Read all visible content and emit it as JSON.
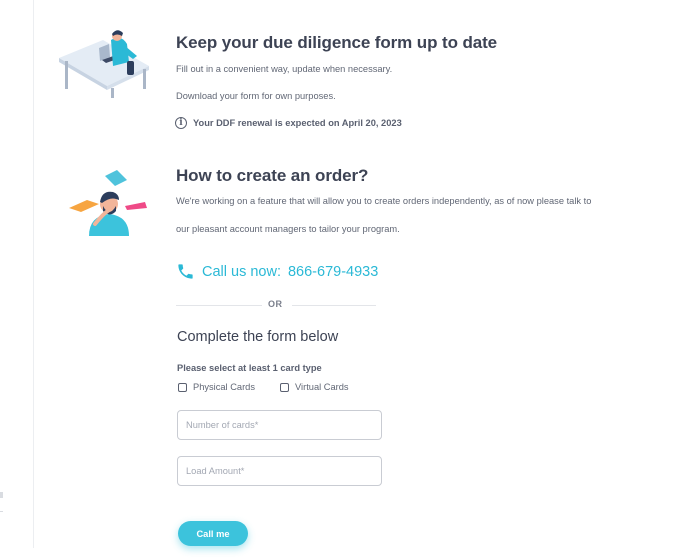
{
  "ddf": {
    "title": "Keep your due diligence form up to date",
    "line1": "Fill out in a convenient way, update when necessary.",
    "line2": "Download your form for own purposes.",
    "notice": "Your DDF renewal is expected on April 20, 2023",
    "notice_icon": "info-icon"
  },
  "order": {
    "title": "How to create an order?",
    "line1": "We're working on a feature that will allow you to create orders independently, as of now please talk to",
    "line2": "our pleasant account managers to tailor your program."
  },
  "call": {
    "label": "Call us now:",
    "number": "866-679-4933",
    "icon": "phone-icon",
    "color": "#2bb9d6"
  },
  "divider": {
    "text": "OR"
  },
  "form": {
    "title": "Complete the form below",
    "card_type_label": "Please select at least 1 card type",
    "options": [
      {
        "label": "Physical Cards",
        "checked": false
      },
      {
        "label": "Virtual Cards",
        "checked": false
      }
    ],
    "number_of_cards": {
      "placeholder": "Number of cards*",
      "value": ""
    },
    "load_amount": {
      "placeholder": "Load Amount*",
      "value": ""
    },
    "submit_label": "Call me",
    "accent": "#3cc3dc"
  }
}
